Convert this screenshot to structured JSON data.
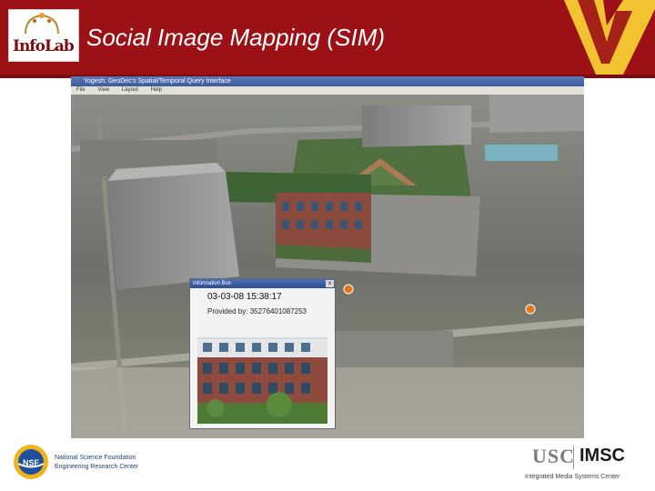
{
  "header": {
    "title": "Social Image Mapping (SIM)",
    "logo_text": "InfoLab"
  },
  "window": {
    "title": "Yogesh: GeoDec's Spatial/Temporal Query Interface",
    "menu": [
      "File",
      "View",
      "Layout",
      "Help"
    ]
  },
  "info_box": {
    "title": "Information Box",
    "close": "x",
    "datetime": "03-03-08 15:38:17",
    "provider": "Provided by: 35276401087253"
  },
  "footer": {
    "nsf_line1": "National Science Foundation",
    "nsf_line2": "Engineering Research Center",
    "nsf_logo_text": "NSF",
    "usc": "USC",
    "imsc": "IMSC",
    "imsc_sub": "Integrated Media Systems Center"
  },
  "colors": {
    "brand_red": "#9b1116",
    "usc_gold": "#f2c230",
    "window_title": "#3d5a9c"
  }
}
